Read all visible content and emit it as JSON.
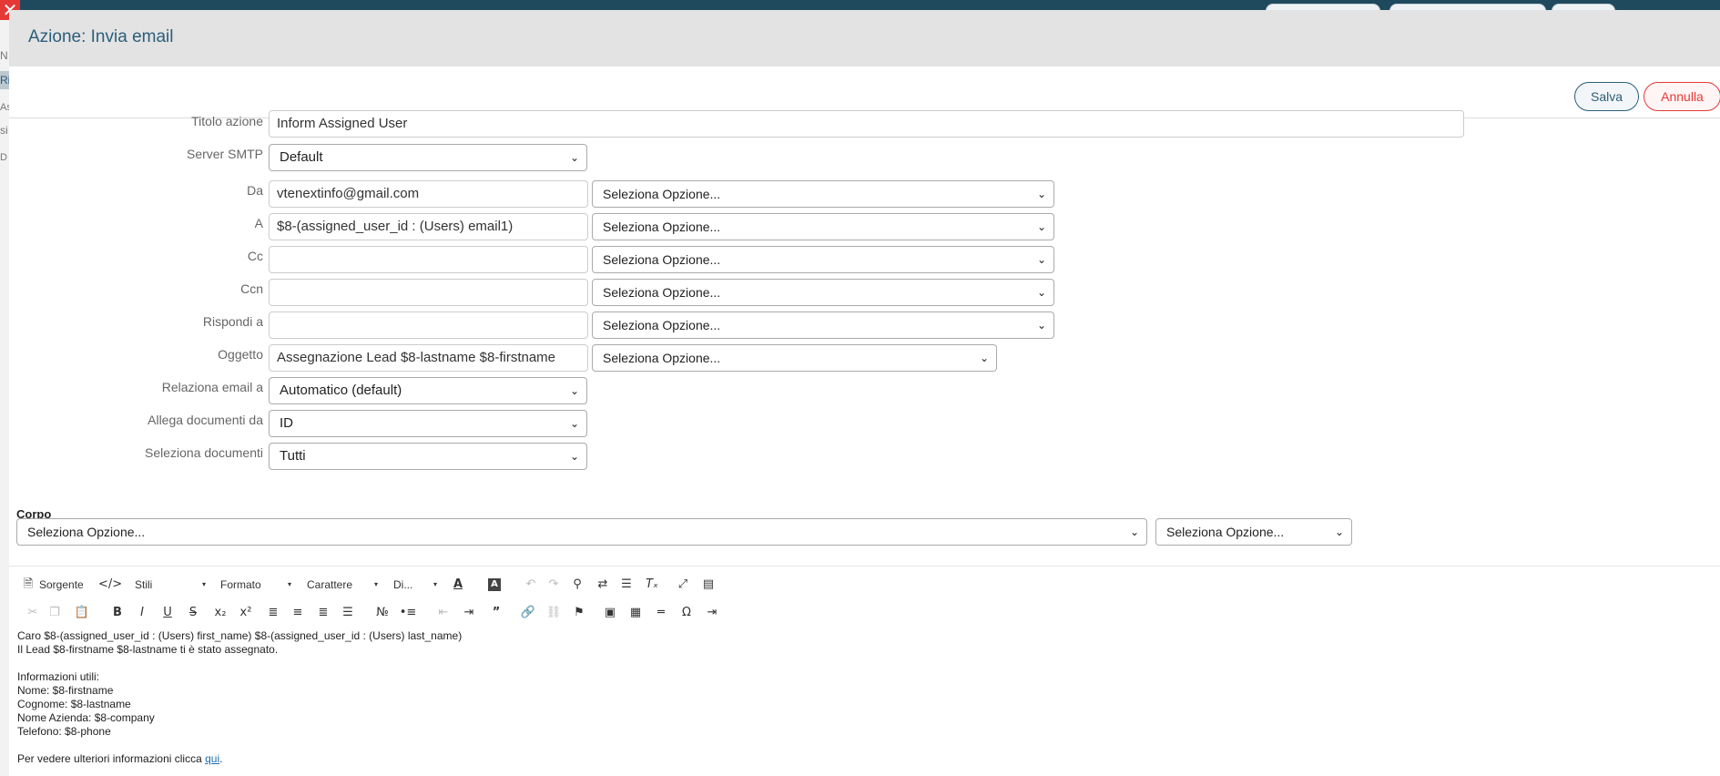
{
  "background": {
    "sidebar_fragments": [
      "N",
      "Ri",
      "As",
      "si",
      "D"
    ]
  },
  "modal": {
    "title": "Azione: Invia email",
    "close_glyph": "✕",
    "save_label": "Salva",
    "cancel_label": "Annulla"
  },
  "form": {
    "titolo_azione": {
      "label": "Titolo azione",
      "value": "Inform Assigned User"
    },
    "server_smtp": {
      "label": "Server SMTP",
      "value": "Default"
    },
    "da": {
      "label": "Da",
      "value": "vtenextinfo@gmail.com",
      "option": "Seleziona Opzione..."
    },
    "a": {
      "label": "A",
      "value": "$8-(assigned_user_id : (Users) email1)",
      "option": "Seleziona Opzione..."
    },
    "cc": {
      "label": "Cc",
      "value": "",
      "option": "Seleziona Opzione..."
    },
    "ccn": {
      "label": "Ccn",
      "value": "",
      "option": "Seleziona Opzione..."
    },
    "rispondi_a": {
      "label": "Rispondi a",
      "value": "",
      "option": "Seleziona Opzione..."
    },
    "oggetto": {
      "label": "Oggetto",
      "value": "Assegnazione Lead $8-lastname $8-firstname",
      "option": "Seleziona Opzione..."
    },
    "relaziona_email": {
      "label": "Relaziona email a",
      "value": "Automatico (default)"
    },
    "allega_documenti": {
      "label": "Allega documenti da",
      "value": "ID"
    },
    "seleziona_documenti": {
      "label": "Seleziona documenti",
      "value": "Tutti"
    }
  },
  "corpo": {
    "title": "Corpo",
    "option_main": "Seleziona Opzione...",
    "option_secondary": "Seleziona Opzione..."
  },
  "editor": {
    "source_label": "Sorgente",
    "styles_label": "Stili",
    "format_label": "Formato",
    "font_label": "Carattere",
    "size_label": "Di...",
    "body_lines": [
      "Caro $8-(assigned_user_id : (Users) first_name) $8-(assigned_user_id : (Users) last_name)",
      "Il Lead $8-firstname $8-lastname ti è stato assegnato.",
      "Informazioni utili:",
      "Nome: $8-firstname",
      "Cognome: $8-lastname",
      "Nome Azienda: $8-company",
      "Telefono: $8-phone"
    ],
    "footer_text": "Per vedere ulteriori informazioni clicca ",
    "footer_link": "qui",
    "footer_end": "."
  }
}
